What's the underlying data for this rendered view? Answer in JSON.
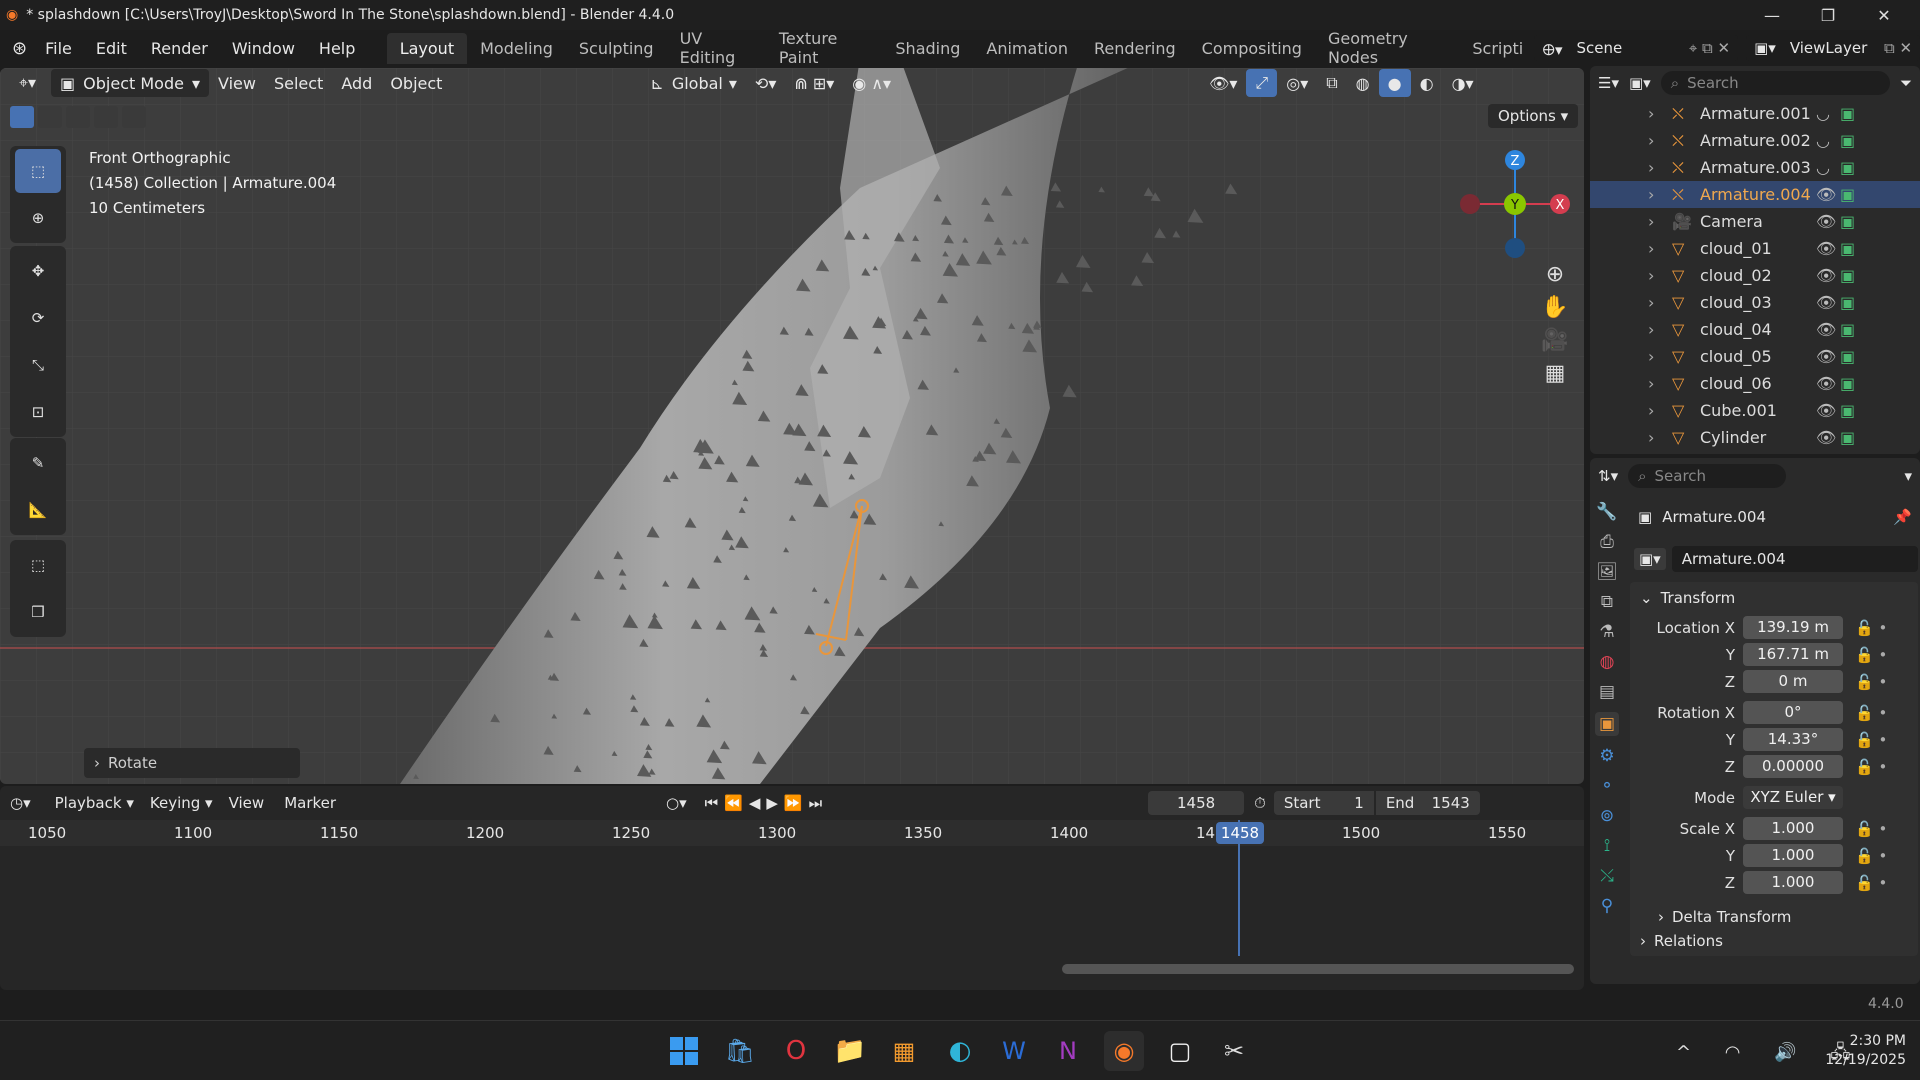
{
  "window": {
    "title": "* splashdown [C:\\Users\\TroyJ\\Desktop\\Sword In The Stone\\splashdown.blend] - Blender 4.4.0"
  },
  "menu": [
    "File",
    "Edit",
    "Render",
    "Window",
    "Help"
  ],
  "workspaces": [
    "Layout",
    "Modeling",
    "Sculpting",
    "UV Editing",
    "Texture Paint",
    "Shading",
    "Animation",
    "Rendering",
    "Compositing",
    "Geometry Nodes",
    "Scripti"
  ],
  "active_workspace": "Layout",
  "scene": {
    "label": "Scene",
    "view_layer": "ViewLayer"
  },
  "viewport": {
    "mode": "Object Mode",
    "menus": [
      "View",
      "Select",
      "Add",
      "Object"
    ],
    "transform_orientation": "Global",
    "options_label": "Options",
    "overlay": {
      "view_name": "Front Orthographic",
      "collection": "(1458) Collection | Armature.004",
      "scale": "10 Centimeters"
    },
    "last_op": "Rotate",
    "gizmo": {
      "z": "Z",
      "y": "Y",
      "x": "X"
    }
  },
  "outliner": {
    "search_placeholder": "Search",
    "items": [
      {
        "name": "Armature.001",
        "icon": "armature-icon",
        "selected": false
      },
      {
        "name": "Armature.002",
        "icon": "armature-icon",
        "selected": false
      },
      {
        "name": "Armature.003",
        "icon": "armature-icon",
        "selected": false
      },
      {
        "name": "Armature.004",
        "icon": "armature-icon",
        "selected": true
      },
      {
        "name": "Camera",
        "icon": "camera-icon",
        "selected": false
      },
      {
        "name": "cloud_01",
        "icon": "mesh-icon",
        "selected": false
      },
      {
        "name": "cloud_02",
        "icon": "mesh-icon",
        "selected": false
      },
      {
        "name": "cloud_03",
        "icon": "mesh-icon",
        "selected": false
      },
      {
        "name": "cloud_04",
        "icon": "mesh-icon",
        "selected": false
      },
      {
        "name": "cloud_05",
        "icon": "mesh-icon",
        "selected": false
      },
      {
        "name": "cloud_06",
        "icon": "mesh-icon",
        "selected": false
      },
      {
        "name": "Cube.001",
        "icon": "mesh-icon",
        "selected": false
      },
      {
        "name": "Cylinder",
        "icon": "mesh-icon",
        "selected": false
      }
    ]
  },
  "properties": {
    "search_placeholder": "Search",
    "object_name": "Armature.004",
    "datablock": "Armature.004",
    "transform_label": "Transform",
    "location": {
      "x": "139.19 m",
      "y": "167.71 m",
      "z": "0 m"
    },
    "rotation": {
      "x": "0°",
      "y": "14.33°",
      "z": "0.00000"
    },
    "mode_label": "Mode",
    "mode": "XYZ Euler",
    "scale": {
      "x": "1.000",
      "y": "1.000",
      "z": "1.000"
    },
    "labels": {
      "location_x": "Location X",
      "rotation_x": "Rotation X",
      "scale_x": "Scale X",
      "y": "Y",
      "z": "Z"
    },
    "delta_label": "Delta Transform",
    "relations_label": "Relations"
  },
  "timeline": {
    "menus": [
      "Playback",
      "Keying",
      "View",
      "Marker"
    ],
    "current_frame": "1458",
    "start_label": "Start",
    "start": "1",
    "end_label": "End",
    "end": "1543",
    "ticks": [
      "1050",
      "1100",
      "1150",
      "1200",
      "1250",
      "1300",
      "1350",
      "1400",
      "14",
      "1500",
      "1550"
    ]
  },
  "statusbar": {
    "version": "4.4.0"
  },
  "taskbar": {
    "time": "2:30 PM",
    "date": "12/19/2025"
  },
  "colors": {
    "accent": "#4772b3",
    "selected_row": "#33476e",
    "bone": "#e8963c",
    "x_axis": "#d43d4f",
    "y_axis": "#8ac700",
    "z_axis": "#2e86de"
  }
}
